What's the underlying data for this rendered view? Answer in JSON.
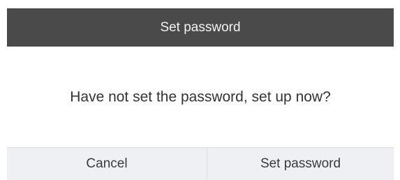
{
  "dialog": {
    "title": "Set password",
    "message": "Have not set the password, set up now?",
    "buttons": {
      "cancel_label": "Cancel",
      "confirm_label": "Set password"
    }
  },
  "colors": {
    "header_background": "#4a4a4a",
    "header_text": "#f2f2f2",
    "body_background": "#ffffff",
    "actions_background": "#eef0f4"
  }
}
